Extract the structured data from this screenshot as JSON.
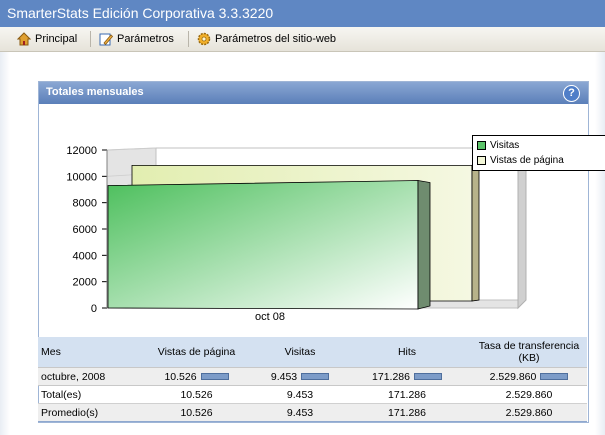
{
  "window": {
    "title": "SmarterStats Edición Corporativa 3.3.3220"
  },
  "toolbar": {
    "items": [
      {
        "label": "Principal"
      },
      {
        "label": "Parámetros"
      },
      {
        "label": "Parámetros del sitio-web"
      }
    ]
  },
  "panel": {
    "title": "Totales mensuales",
    "help": "?"
  },
  "chart_data": {
    "type": "bar",
    "categories": [
      "oct 08"
    ],
    "series": [
      {
        "name": "Visitas",
        "values": [
          9453
        ],
        "color": "#5cc46a"
      },
      {
        "name": "Vistas de página",
        "values": [
          10526
        ],
        "color": "#e6f0b8"
      }
    ],
    "ylim": [
      0,
      12000
    ],
    "yticks": [
      "12000",
      "10000",
      "8000",
      "6000",
      "4000",
      "2000",
      "0"
    ],
    "legend_position": "top-right",
    "three_d": true
  },
  "table": {
    "headers": [
      "Mes",
      "Vistas de página",
      "Visitas",
      "Hits",
      "Tasa de transferencia (KB)"
    ],
    "header_lines": {
      "transfer_1": "Tasa de transferencia",
      "transfer_2": "(KB)"
    },
    "rows": [
      {
        "label": "octubre, 2008",
        "pageviews": "10.526",
        "visits": "9.453",
        "hits": "171.286",
        "transfer": "2.529.860"
      },
      {
        "label": "Total(es)",
        "pageviews": "10.526",
        "visits": "9.453",
        "hits": "171.286",
        "transfer": "2.529.860"
      },
      {
        "label": "Promedio(s)",
        "pageviews": "10.526",
        "visits": "9.453",
        "hits": "171.286",
        "transfer": "2.529.860"
      }
    ]
  }
}
